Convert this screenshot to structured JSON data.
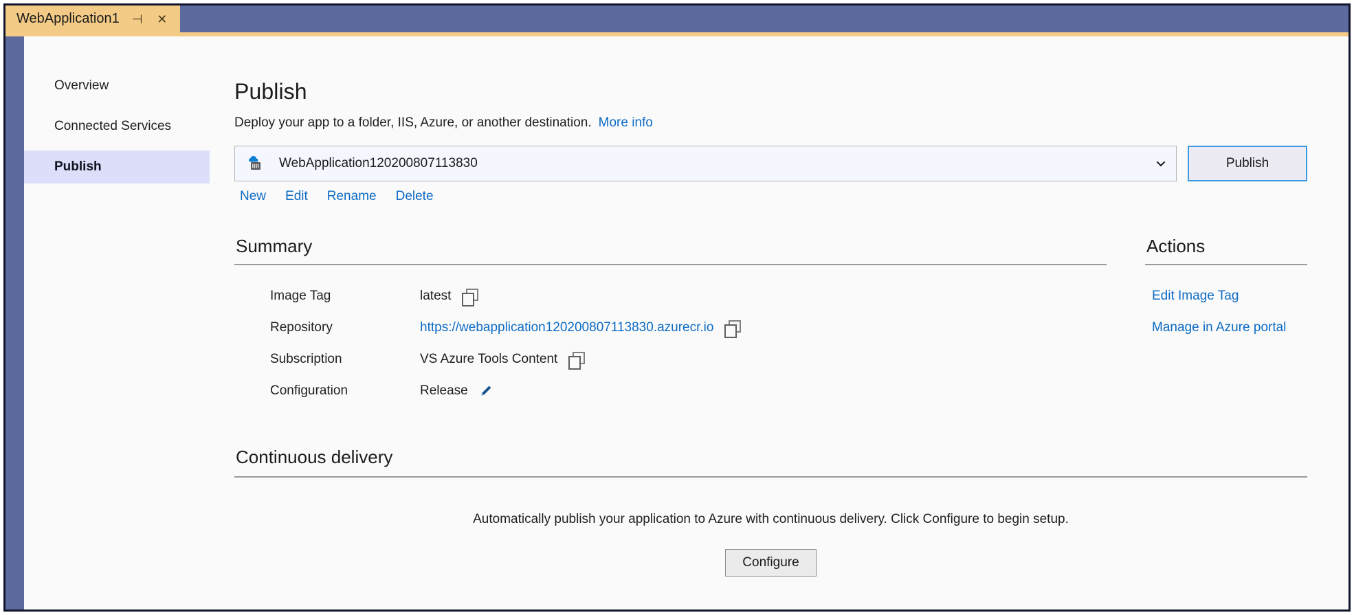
{
  "window": {
    "tab": {
      "title": "WebApplication1",
      "pin_icon": "pin-icon",
      "close_icon": "close-icon",
      "pin_glyph": "⊣",
      "close_glyph": "✕"
    },
    "frame_color": "#5d6a9e",
    "tab_color": "#f4cb86",
    "border_color": "#11162b"
  },
  "sidebar": {
    "items": [
      {
        "label": "Overview",
        "selected": false
      },
      {
        "label": "Connected Services",
        "selected": false
      },
      {
        "label": "Publish",
        "selected": true
      }
    ],
    "selected_bg": "#dcdefa"
  },
  "main": {
    "title": "Publish",
    "subtitle": "Deploy your app to a folder, IIS, Azure, or another destination.",
    "more_info_label": "More info",
    "profile": {
      "selected": "WebApplication120200807113830",
      "icon": "azure-container-registry-icon",
      "chevron_icon": "chevron-down-icon",
      "publish_button_label": "Publish",
      "links": [
        {
          "label": "New"
        },
        {
          "label": "Edit"
        },
        {
          "label": "Rename"
        },
        {
          "label": "Delete"
        }
      ]
    },
    "summary": {
      "heading": "Summary",
      "rows": [
        {
          "label": "Image Tag",
          "value": "latest",
          "is_link": false,
          "trailing_icon": "copy-icon"
        },
        {
          "label": "Repository",
          "value": "https://webapplication120200807113830.azurecr.io",
          "is_link": true,
          "trailing_icon": "copy-icon"
        },
        {
          "label": "Subscription",
          "value": "VS Azure Tools Content",
          "is_link": false,
          "trailing_icon": "copy-icon"
        },
        {
          "label": "Configuration",
          "value": "Release",
          "is_link": false,
          "trailing_icon": "pencil-icon"
        }
      ]
    },
    "actions": {
      "heading": "Actions",
      "links": [
        {
          "label": "Edit Image Tag"
        },
        {
          "label": "Manage in Azure portal"
        }
      ]
    },
    "continuous_delivery": {
      "heading": "Continuous delivery",
      "description": "Automatically publish your application to Azure with continuous delivery. Click Configure to begin setup.",
      "button_label": "Configure"
    }
  },
  "colors": {
    "link": "#0d6bc4",
    "accent_blue": "#3b9ae1",
    "pencil_blue": "#17548c",
    "cloud_blue": "#0f7fd4",
    "text": "#1f1f1f",
    "rule": "#9b9b9b"
  }
}
